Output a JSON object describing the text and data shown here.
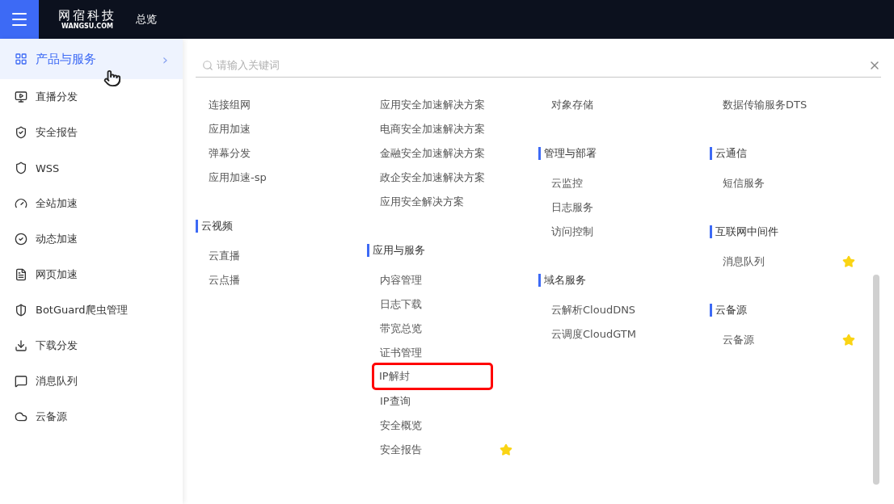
{
  "header": {
    "logo_cn": "网宿科技",
    "logo_en": "WANGSU.COM",
    "nav": [
      {
        "label": "总览"
      }
    ]
  },
  "sidebar": {
    "items": [
      {
        "label": "产品与服务",
        "selected": true,
        "chevron": "›"
      },
      {
        "label": "直播分发",
        "selected": false
      },
      {
        "label": "安全报告",
        "selected": false
      },
      {
        "label": "WSS",
        "selected": false
      },
      {
        "label": "全站加速",
        "selected": false
      },
      {
        "label": "动态加速",
        "selected": false
      },
      {
        "label": "网页加速",
        "selected": false
      },
      {
        "label": "BotGuard爬虫管理",
        "selected": false
      },
      {
        "label": "下载分发",
        "selected": false
      },
      {
        "label": "消息队列",
        "selected": false
      },
      {
        "label": "云备源",
        "selected": false
      }
    ]
  },
  "search": {
    "placeholder": "请输入关键词"
  },
  "columns": [
    [
      {
        "items": [
          {
            "label": "连接组网",
            "starred": false,
            "highlighted": false
          },
          {
            "label": "应用加速",
            "starred": false,
            "highlighted": false
          },
          {
            "label": "弹幕分发",
            "starred": false,
            "highlighted": false
          },
          {
            "label": "应用加速-sp",
            "starred": false,
            "highlighted": false
          }
        ]
      },
      {
        "heading": "云视频",
        "items": [
          {
            "label": "云直播",
            "starred": false,
            "highlighted": false
          },
          {
            "label": "云点播",
            "starred": false,
            "highlighted": false
          }
        ]
      }
    ],
    [
      {
        "items": [
          {
            "label": "应用安全加速解决方案",
            "starred": false,
            "highlighted": false
          },
          {
            "label": "电商安全加速解决方案",
            "starred": false,
            "highlighted": false
          },
          {
            "label": "金融安全加速解决方案",
            "starred": false,
            "highlighted": false
          },
          {
            "label": "政企安全加速解决方案",
            "starred": false,
            "highlighted": false
          },
          {
            "label": "应用安全解决方案",
            "starred": false,
            "highlighted": false
          }
        ]
      },
      {
        "heading": "应用与服务",
        "items": [
          {
            "label": "内容管理",
            "starred": false,
            "highlighted": false
          },
          {
            "label": "日志下载",
            "starred": false,
            "highlighted": false
          },
          {
            "label": "带宽总览",
            "starred": false,
            "highlighted": false
          },
          {
            "label": "证书管理",
            "starred": false,
            "highlighted": false
          },
          {
            "label": "IP解封",
            "starred": false,
            "highlighted": true
          },
          {
            "label": "IP查询",
            "starred": false,
            "highlighted": false
          },
          {
            "label": "安全概览",
            "starred": false,
            "highlighted": false
          },
          {
            "label": "安全报告",
            "starred": true,
            "highlighted": false
          }
        ]
      }
    ],
    [
      {
        "items": [
          {
            "label": "对象存储",
            "starred": false,
            "highlighted": false
          }
        ]
      },
      {
        "heading": "管理与部署",
        "items": [
          {
            "label": "云监控",
            "starred": false,
            "highlighted": false
          },
          {
            "label": "日志服务",
            "starred": false,
            "highlighted": false
          },
          {
            "label": "访问控制",
            "starred": false,
            "highlighted": false
          }
        ]
      },
      {
        "heading": "域名服务",
        "items": [
          {
            "label": "云解析CloudDNS",
            "starred": false,
            "highlighted": false
          },
          {
            "label": "云调度CloudGTM",
            "starred": false,
            "highlighted": false
          }
        ]
      }
    ],
    [
      {
        "items": [
          {
            "label": "数据传输服务DTS",
            "starred": false,
            "highlighted": false
          }
        ]
      },
      {
        "heading": "云通信",
        "items": [
          {
            "label": "短信服务",
            "starred": false,
            "highlighted": false
          }
        ]
      },
      {
        "heading": "互联网中间件",
        "items": [
          {
            "label": "消息队列",
            "starred": true,
            "highlighted": false
          }
        ]
      },
      {
        "heading": "云备源",
        "items": [
          {
            "label": "云备源",
            "starred": true,
            "highlighted": false
          }
        ]
      }
    ]
  ]
}
